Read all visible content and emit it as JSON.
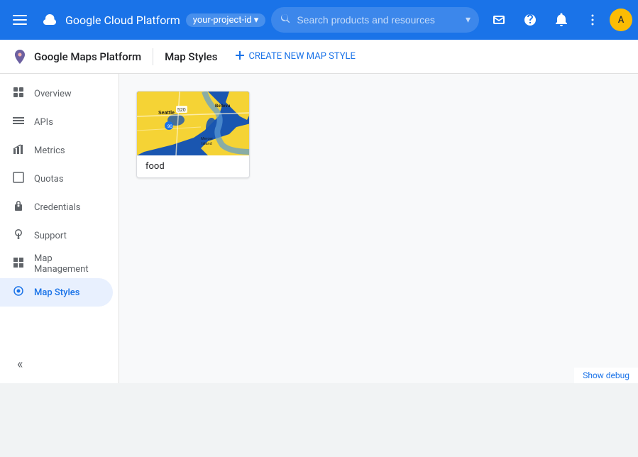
{
  "topbar": {
    "title": "Google Cloud Platform",
    "account_chip": "your-project-id",
    "search_placeholder": "Search products and resources",
    "icons": {
      "menu": "☰",
      "search": "🔍",
      "dropdown": "▾",
      "email": "✉",
      "help": "?",
      "bell": "🔔",
      "dots": "⋮"
    }
  },
  "subheader": {
    "brand": "Google Maps Platform",
    "page_title": "Map Styles",
    "create_button": "CREATE NEW MAP STYLE",
    "create_icon": "+"
  },
  "sidebar": {
    "items": [
      {
        "id": "overview",
        "label": "Overview",
        "icon": "⊞"
      },
      {
        "id": "apis",
        "label": "APIs",
        "icon": "≡"
      },
      {
        "id": "metrics",
        "label": "Metrics",
        "icon": "↑"
      },
      {
        "id": "quotas",
        "label": "Quotas",
        "icon": "□"
      },
      {
        "id": "credentials",
        "label": "Credentials",
        "icon": "⚿"
      },
      {
        "id": "support",
        "label": "Support",
        "icon": "👤"
      },
      {
        "id": "map-management",
        "label": "Map Management",
        "icon": "▦"
      },
      {
        "id": "map-styles",
        "label": "Map Styles",
        "icon": "◎",
        "active": true
      }
    ],
    "collapse_icon": "«"
  },
  "main": {
    "cards": [
      {
        "id": "food",
        "label": "food"
      }
    ]
  },
  "bottom_bar": {
    "label": "Show debug"
  },
  "colors": {
    "topbar_bg": "#1a73e8",
    "active_item": "#1a73e8",
    "active_bg": "#e8f0fe",
    "map_blue": "#1a56b0",
    "map_yellow": "#f5d335",
    "map_light_blue": "#a8d4f5"
  }
}
